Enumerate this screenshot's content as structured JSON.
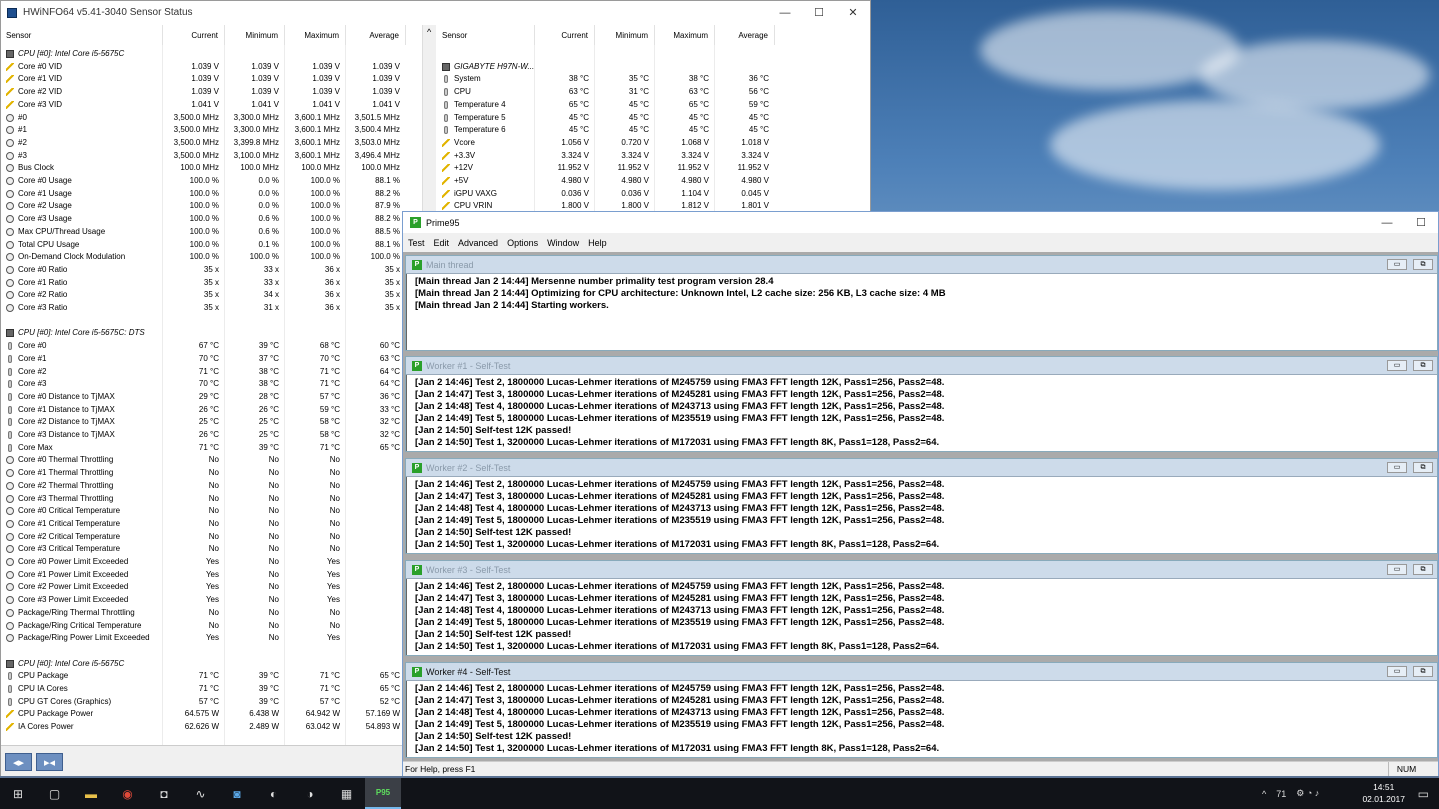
{
  "hwinfo": {
    "title": "HWiNFO64 v5.41-3040 Sensor Status",
    "win_min": "—",
    "win_max": "☐",
    "win_close": "✕",
    "columns": [
      "Sensor",
      "Current",
      "Minimum",
      "Maximum",
      "Average"
    ],
    "left_rows": [
      {
        "type": "grp",
        "name": "CPU [#0]: Intel Core i5-5675C"
      },
      {
        "type": "volt",
        "name": "Core #0 VID",
        "cur": "1.039 V",
        "min": "1.039 V",
        "max": "1.039 V",
        "avg": "1.039 V"
      },
      {
        "type": "volt",
        "name": "Core #1 VID",
        "cur": "1.039 V",
        "min": "1.039 V",
        "max": "1.039 V",
        "avg": "1.039 V"
      },
      {
        "type": "volt",
        "name": "Core #2 VID",
        "cur": "1.039 V",
        "min": "1.039 V",
        "max": "1.039 V",
        "avg": "1.039 V"
      },
      {
        "type": "volt",
        "name": "Core #3 VID",
        "cur": "1.041 V",
        "min": "1.041 V",
        "max": "1.041 V",
        "avg": "1.041 V"
      },
      {
        "type": "clk",
        "name": "#0",
        "cur": "3,500.0 MHz",
        "min": "3,300.0 MHz",
        "max": "3,600.1 MHz",
        "avg": "3,501.5 MHz"
      },
      {
        "type": "clk",
        "name": "#1",
        "cur": "3,500.0 MHz",
        "min": "3,300.0 MHz",
        "max": "3,600.1 MHz",
        "avg": "3,500.4 MHz"
      },
      {
        "type": "clk",
        "name": "#2",
        "cur": "3,500.0 MHz",
        "min": "3,399.8 MHz",
        "max": "3,600.1 MHz",
        "avg": "3,503.0 MHz"
      },
      {
        "type": "clk",
        "name": "#3",
        "cur": "3,500.0 MHz",
        "min": "3,100.0 MHz",
        "max": "3,600.1 MHz",
        "avg": "3,496.4 MHz"
      },
      {
        "type": "clk",
        "name": "Bus Clock",
        "cur": "100.0 MHz",
        "min": "100.0 MHz",
        "max": "100.0 MHz",
        "avg": "100.0 MHz"
      },
      {
        "type": "clk",
        "name": "Core #0 Usage",
        "cur": "100.0 %",
        "min": "0.0 %",
        "max": "100.0 %",
        "avg": "88.1 %"
      },
      {
        "type": "clk",
        "name": "Core #1 Usage",
        "cur": "100.0 %",
        "min": "0.0 %",
        "max": "100.0 %",
        "avg": "88.2 %"
      },
      {
        "type": "clk",
        "name": "Core #2 Usage",
        "cur": "100.0 %",
        "min": "0.0 %",
        "max": "100.0 %",
        "avg": "87.9 %"
      },
      {
        "type": "clk",
        "name": "Core #3 Usage",
        "cur": "100.0 %",
        "min": "0.6 %",
        "max": "100.0 %",
        "avg": "88.2 %"
      },
      {
        "type": "clk",
        "name": "Max CPU/Thread Usage",
        "cur": "100.0 %",
        "min": "0.6 %",
        "max": "100.0 %",
        "avg": "88.5 %"
      },
      {
        "type": "clk",
        "name": "Total CPU Usage",
        "cur": "100.0 %",
        "min": "0.1 %",
        "max": "100.0 %",
        "avg": "88.1 %"
      },
      {
        "type": "clk",
        "name": "On-Demand Clock Modulation",
        "cur": "100.0 %",
        "min": "100.0 %",
        "max": "100.0 %",
        "avg": "100.0 %"
      },
      {
        "type": "clk",
        "name": "Core #0 Ratio",
        "cur": "35 x",
        "min": "33 x",
        "max": "36 x",
        "avg": "35 x"
      },
      {
        "type": "clk",
        "name": "Core #1 Ratio",
        "cur": "35 x",
        "min": "33 x",
        "max": "36 x",
        "avg": "35 x"
      },
      {
        "type": "clk",
        "name": "Core #2 Ratio",
        "cur": "35 x",
        "min": "34 x",
        "max": "36 x",
        "avg": "35 x"
      },
      {
        "type": "clk",
        "name": "Core #3 Ratio",
        "cur": "35 x",
        "min": "31 x",
        "max": "36 x",
        "avg": "35 x"
      },
      {
        "type": "blank",
        "name": ""
      },
      {
        "type": "grp",
        "name": "CPU [#0]: Intel Core i5-5675C: DTS"
      },
      {
        "type": "temp",
        "name": "Core #0",
        "cur": "67 °C",
        "min": "39 °C",
        "max": "68 °C",
        "avg": "60 °C"
      },
      {
        "type": "temp",
        "name": "Core #1",
        "cur": "70 °C",
        "min": "37 °C",
        "max": "70 °C",
        "avg": "63 °C"
      },
      {
        "type": "temp",
        "name": "Core #2",
        "cur": "71 °C",
        "min": "38 °C",
        "max": "71 °C",
        "avg": "64 °C"
      },
      {
        "type": "temp",
        "name": "Core #3",
        "cur": "70 °C",
        "min": "38 °C",
        "max": "71 °C",
        "avg": "64 °C"
      },
      {
        "type": "temp",
        "name": "Core #0 Distance to TjMAX",
        "cur": "29 °C",
        "min": "28 °C",
        "max": "57 °C",
        "avg": "36 °C"
      },
      {
        "type": "temp",
        "name": "Core #1 Distance to TjMAX",
        "cur": "26 °C",
        "min": "26 °C",
        "max": "59 °C",
        "avg": "33 °C"
      },
      {
        "type": "temp",
        "name": "Core #2 Distance to TjMAX",
        "cur": "25 °C",
        "min": "25 °C",
        "max": "58 °C",
        "avg": "32 °C"
      },
      {
        "type": "temp",
        "name": "Core #3 Distance to TjMAX",
        "cur": "26 °C",
        "min": "25 °C",
        "max": "58 °C",
        "avg": "32 °C"
      },
      {
        "type": "temp",
        "name": "Core Max",
        "cur": "71 °C",
        "min": "39 °C",
        "max": "71 °C",
        "avg": "65 °C"
      },
      {
        "type": "clk",
        "name": "Core #0 Thermal Throttling",
        "cur": "No",
        "min": "No",
        "max": "No",
        "avg": ""
      },
      {
        "type": "clk",
        "name": "Core #1 Thermal Throttling",
        "cur": "No",
        "min": "No",
        "max": "No",
        "avg": ""
      },
      {
        "type": "clk",
        "name": "Core #2 Thermal Throttling",
        "cur": "No",
        "min": "No",
        "max": "No",
        "avg": ""
      },
      {
        "type": "clk",
        "name": "Core #3 Thermal Throttling",
        "cur": "No",
        "min": "No",
        "max": "No",
        "avg": ""
      },
      {
        "type": "clk",
        "name": "Core #0 Critical Temperature",
        "cur": "No",
        "min": "No",
        "max": "No",
        "avg": ""
      },
      {
        "type": "clk",
        "name": "Core #1 Critical Temperature",
        "cur": "No",
        "min": "No",
        "max": "No",
        "avg": ""
      },
      {
        "type": "clk",
        "name": "Core #2 Critical Temperature",
        "cur": "No",
        "min": "No",
        "max": "No",
        "avg": ""
      },
      {
        "type": "clk",
        "name": "Core #3 Critical Temperature",
        "cur": "No",
        "min": "No",
        "max": "No",
        "avg": ""
      },
      {
        "type": "clk",
        "name": "Core #0 Power Limit Exceeded",
        "cur": "Yes",
        "min": "No",
        "max": "Yes",
        "avg": ""
      },
      {
        "type": "clk",
        "name": "Core #1 Power Limit Exceeded",
        "cur": "Yes",
        "min": "No",
        "max": "Yes",
        "avg": ""
      },
      {
        "type": "clk",
        "name": "Core #2 Power Limit Exceeded",
        "cur": "Yes",
        "min": "No",
        "max": "Yes",
        "avg": ""
      },
      {
        "type": "clk",
        "name": "Core #3 Power Limit Exceeded",
        "cur": "Yes",
        "min": "No",
        "max": "Yes",
        "avg": ""
      },
      {
        "type": "clk",
        "name": "Package/Ring Thermal Throttling",
        "cur": "No",
        "min": "No",
        "max": "No",
        "avg": ""
      },
      {
        "type": "clk",
        "name": "Package/Ring Critical Temperature",
        "cur": "No",
        "min": "No",
        "max": "No",
        "avg": ""
      },
      {
        "type": "clk",
        "name": "Package/Ring Power Limit Exceeded",
        "cur": "Yes",
        "min": "No",
        "max": "Yes",
        "avg": ""
      },
      {
        "type": "blank",
        "name": ""
      },
      {
        "type": "grp",
        "name": "CPU [#0]: Intel Core i5-5675C"
      },
      {
        "type": "temp",
        "name": "CPU Package",
        "cur": "71 °C",
        "min": "39 °C",
        "max": "71 °C",
        "avg": "65 °C"
      },
      {
        "type": "temp",
        "name": "CPU IA Cores",
        "cur": "71 °C",
        "min": "39 °C",
        "max": "71 °C",
        "avg": "65 °C"
      },
      {
        "type": "temp",
        "name": "CPU GT Cores (Graphics)",
        "cur": "57 °C",
        "min": "39 °C",
        "max": "57 °C",
        "avg": "52 °C"
      },
      {
        "type": "pwr",
        "name": "CPU Package Power",
        "cur": "64.575 W",
        "min": "6.438 W",
        "max": "64.942 W",
        "avg": "57.169 W"
      },
      {
        "type": "pwr",
        "name": "IA Cores Power",
        "cur": "62.626 W",
        "min": "2.489 W",
        "max": "63.042 W",
        "avg": "54.893 W"
      }
    ],
    "right_rows": [
      {
        "type": "blank",
        "name": ""
      },
      {
        "type": "grp",
        "name": "GIGABYTE H97N-W..."
      },
      {
        "type": "temp",
        "name": "System",
        "cur": "38 °C",
        "min": "35 °C",
        "max": "38 °C",
        "avg": "36 °C"
      },
      {
        "type": "temp",
        "name": "CPU",
        "cur": "63 °C",
        "min": "31 °C",
        "max": "63 °C",
        "avg": "56 °C"
      },
      {
        "type": "temp",
        "name": "Temperature 4",
        "cur": "65 °C",
        "min": "45 °C",
        "max": "65 °C",
        "avg": "59 °C"
      },
      {
        "type": "temp",
        "name": "Temperature 5",
        "cur": "45 °C",
        "min": "45 °C",
        "max": "45 °C",
        "avg": "45 °C"
      },
      {
        "type": "temp",
        "name": "Temperature 6",
        "cur": "45 °C",
        "min": "45 °C",
        "max": "45 °C",
        "avg": "45 °C"
      },
      {
        "type": "volt",
        "name": "Vcore",
        "cur": "1.056 V",
        "min": "0.720 V",
        "max": "1.068 V",
        "avg": "1.018 V"
      },
      {
        "type": "volt",
        "name": "+3.3V",
        "cur": "3.324 V",
        "min": "3.324 V",
        "max": "3.324 V",
        "avg": "3.324 V"
      },
      {
        "type": "volt",
        "name": "+12V",
        "cur": "11.952 V",
        "min": "11.952 V",
        "max": "11.952 V",
        "avg": "11.952 V"
      },
      {
        "type": "volt",
        "name": "+5V",
        "cur": "4.980 V",
        "min": "4.980 V",
        "max": "4.980 V",
        "avg": "4.980 V"
      },
      {
        "type": "volt",
        "name": "iGPU VAXG",
        "cur": "0.036 V",
        "min": "0.036 V",
        "max": "1.104 V",
        "avg": "0.045 V"
      },
      {
        "type": "volt",
        "name": "CPU VRIN",
        "cur": "1.800 V",
        "min": "1.800 V",
        "max": "1.812 V",
        "avg": "1.801 V"
      }
    ],
    "scroll_up": "^",
    "nav_left": "◂▸",
    "nav_right": "▸◂"
  },
  "prime95": {
    "title": "Prime95",
    "win_min": "—",
    "win_max": "☐",
    "menu": [
      "Test",
      "Edit",
      "Advanced",
      "Options",
      "Window",
      "Help"
    ],
    "windows": [
      {
        "title": "Main thread",
        "active": false,
        "lines": [
          "[Main thread Jan 2 14:44] Mersenne number primality test program version 28.4",
          "[Main thread Jan 2 14:44] Optimizing for CPU architecture: Unknown Intel, L2 cache size: 256 KB, L3 cache size: 4 MB",
          "[Main thread Jan 2 14:44] Starting workers."
        ]
      },
      {
        "title": "Worker #1 - Self-Test",
        "active": false,
        "lines": [
          "[Jan 2 14:46] Test 2, 1800000 Lucas-Lehmer iterations of M245759 using FMA3 FFT length 12K, Pass1=256, Pass2=48.",
          "[Jan 2 14:47] Test 3, 1800000 Lucas-Lehmer iterations of M245281 using FMA3 FFT length 12K, Pass1=256, Pass2=48.",
          "[Jan 2 14:48] Test 4, 1800000 Lucas-Lehmer iterations of M243713 using FMA3 FFT length 12K, Pass1=256, Pass2=48.",
          "[Jan 2 14:49] Test 5, 1800000 Lucas-Lehmer iterations of M235519 using FMA3 FFT length 12K, Pass1=256, Pass2=48.",
          "[Jan 2 14:50] Self-test 12K passed!",
          "[Jan 2 14:50] Test 1, 3200000 Lucas-Lehmer iterations of M172031 using FMA3 FFT length 8K, Pass1=128, Pass2=64."
        ]
      },
      {
        "title": "Worker #2 - Self-Test",
        "active": false,
        "lines": [
          "[Jan 2 14:46] Test 2, 1800000 Lucas-Lehmer iterations of M245759 using FMA3 FFT length 12K, Pass1=256, Pass2=48.",
          "[Jan 2 14:47] Test 3, 1800000 Lucas-Lehmer iterations of M245281 using FMA3 FFT length 12K, Pass1=256, Pass2=48.",
          "[Jan 2 14:48] Test 4, 1800000 Lucas-Lehmer iterations of M243713 using FMA3 FFT length 12K, Pass1=256, Pass2=48.",
          "[Jan 2 14:49] Test 5, 1800000 Lucas-Lehmer iterations of M235519 using FMA3 FFT length 12K, Pass1=256, Pass2=48.",
          "[Jan 2 14:50] Self-test 12K passed!",
          "[Jan 2 14:50] Test 1, 3200000 Lucas-Lehmer iterations of M172031 using FMA3 FFT length 8K, Pass1=128, Pass2=64."
        ]
      },
      {
        "title": "Worker #3 - Self-Test",
        "active": false,
        "lines": [
          "[Jan 2 14:46] Test 2, 1800000 Lucas-Lehmer iterations of M245759 using FMA3 FFT length 12K, Pass1=256, Pass2=48.",
          "[Jan 2 14:47] Test 3, 1800000 Lucas-Lehmer iterations of M245281 using FMA3 FFT length 12K, Pass1=256, Pass2=48.",
          "[Jan 2 14:48] Test 4, 1800000 Lucas-Lehmer iterations of M243713 using FMA3 FFT length 12K, Pass1=256, Pass2=48.",
          "[Jan 2 14:49] Test 5, 1800000 Lucas-Lehmer iterations of M235519 using FMA3 FFT length 12K, Pass1=256, Pass2=48.",
          "[Jan 2 14:50] Self-test 12K passed!",
          "[Jan 2 14:50] Test 1, 3200000 Lucas-Lehmer iterations of M172031 using FMA3 FFT length 8K, Pass1=128, Pass2=64."
        ]
      },
      {
        "title": "Worker #4 - Self-Test",
        "active": true,
        "lines": [
          "[Jan 2 14:46] Test 2, 1800000 Lucas-Lehmer iterations of M245759 using FMA3 FFT length 12K, Pass1=256, Pass2=48.",
          "[Jan 2 14:47] Test 3, 1800000 Lucas-Lehmer iterations of M245281 using FMA3 FFT length 12K, Pass1=256, Pass2=48.",
          "[Jan 2 14:48] Test 4, 1800000 Lucas-Lehmer iterations of M243713 using FMA3 FFT length 12K, Pass1=256, Pass2=48.",
          "[Jan 2 14:49] Test 5, 1800000 Lucas-Lehmer iterations of M235519 using FMA3 FFT length 12K, Pass1=256, Pass2=48.",
          "[Jan 2 14:50] Self-test 12K passed!",
          "[Jan 2 14:50] Test 1, 3200000 Lucas-Lehmer iterations of M172031 using FMA3 FFT length 8K, Pass1=128, Pass2=64."
        ]
      }
    ],
    "mdi_min": "▭",
    "mdi_restore": "⧉",
    "status_text": "For Help, press F1",
    "status_num": "NUM"
  },
  "taskbar": {
    "apps": [
      {
        "name": "start-icon",
        "glyph": "⊞"
      },
      {
        "name": "task-view-icon",
        "glyph": "▢"
      },
      {
        "name": "file-explorer-icon",
        "glyph": "▬"
      },
      {
        "name": "chrome-icon",
        "glyph": "◉"
      },
      {
        "name": "discord-icon",
        "glyph": "◘"
      },
      {
        "name": "hwinfo-icon",
        "glyph": "∿"
      },
      {
        "name": "app-icon",
        "glyph": "◙"
      },
      {
        "name": "steam-icon",
        "glyph": "◐"
      },
      {
        "name": "media-icon",
        "glyph": "◑"
      },
      {
        "name": "calendar-app-icon",
        "glyph": "▦"
      },
      {
        "name": "prime95-icon",
        "glyph": "P95"
      }
    ],
    "tray_chevron": "^",
    "tray_temp": "71",
    "tray_icons": "⚙ ◔ ♪",
    "time": "14:51",
    "date": "02.01.2017",
    "notify": "▭"
  }
}
